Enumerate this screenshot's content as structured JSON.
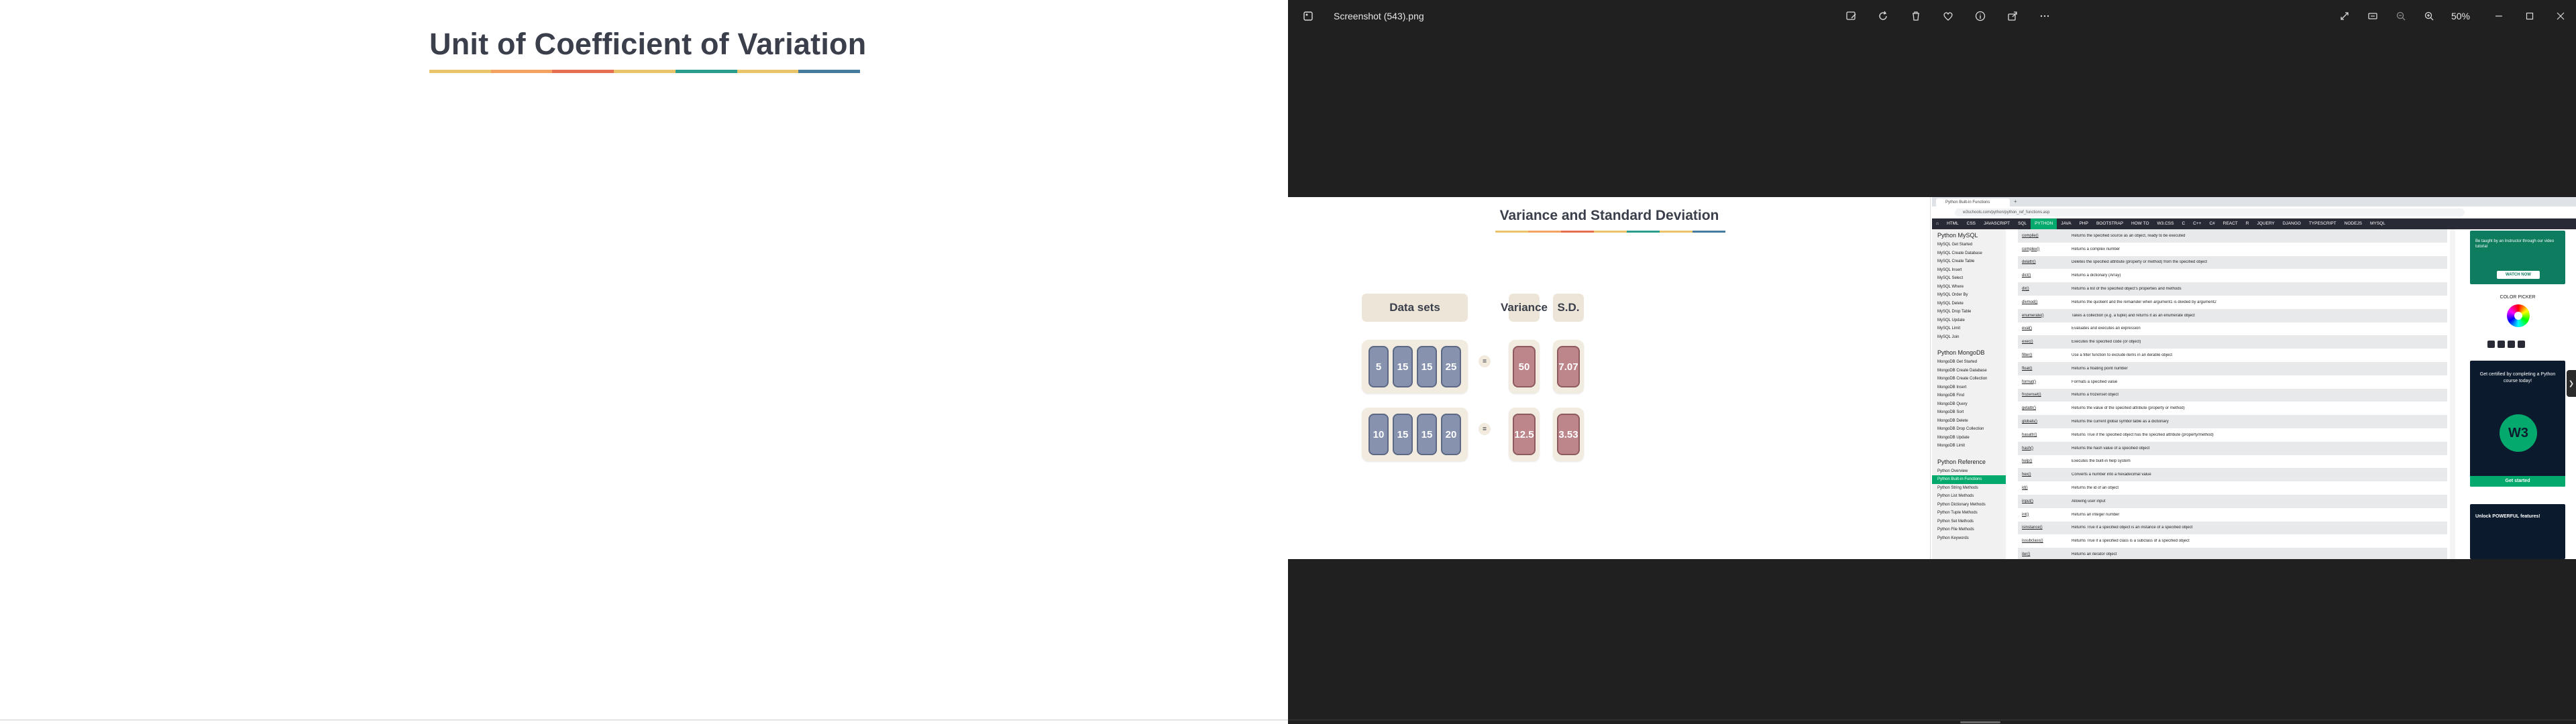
{
  "left_slide": {
    "title": "Unit of Coefficient of Variation",
    "stripe_colors": [
      "#e9c46a",
      "#f4a261",
      "#e76f51",
      "#e9c46a",
      "#2a9d8f",
      "#e9c46a",
      "#457b9d"
    ]
  },
  "viewer": {
    "file_name": "Screenshot (543).png",
    "zoom": "50%",
    "background": "#202020",
    "toolbar_icons": [
      "edit-image-icon",
      "rotate-icon",
      "delete-icon",
      "favorite-icon",
      "info-icon",
      "share-icon",
      "more-icon"
    ],
    "right_icons": [
      "expand-icon",
      "slideshow-icon",
      "zoom-out-icon",
      "zoom-in-icon"
    ],
    "window_controls": [
      "minimize-icon",
      "maximize-icon",
      "close-icon"
    ]
  },
  "screenshot": {
    "slide": {
      "title": "Variance and Standard Deviation",
      "headers": {
        "data_sets": "Data sets",
        "variance": "Variance",
        "sd": "S.D."
      },
      "rows": [
        {
          "values": [
            "5",
            "15",
            "15",
            "25"
          ],
          "eq": "=",
          "variance": "50",
          "sd": "7.07"
        },
        {
          "values": [
            "10",
            "15",
            "15",
            "20"
          ],
          "eq": "=",
          "variance": "12.5",
          "sd": "3.53"
        }
      ]
    },
    "browser": {
      "tab_title": "Python Built-in Functions",
      "url": "w3schools.com/python/python_ref_functions.asp",
      "nav_items": [
        "HTML",
        "CSS",
        "JAVASCRIPT",
        "SQL",
        "PYTHON",
        "JAVA",
        "PHP",
        "BOOTSTRAP",
        "HOW TO",
        "W3.CSS",
        "C",
        "C++",
        "C#",
        "REACT",
        "R",
        "JQUERY",
        "DJANGO",
        "TYPESCRIPT",
        "NODEJS",
        "MYSQL"
      ],
      "active_nav": "PYTHON",
      "sidebar": {
        "section1_title": "Python MySQL",
        "section1_items": [
          "MySQL Get Started",
          "MySQL Create Database",
          "MySQL Create Table",
          "MySQL Insert",
          "MySQL Select",
          "MySQL Where",
          "MySQL Order By",
          "MySQL Delete",
          "MySQL Drop Table",
          "MySQL Update",
          "MySQL Limit",
          "MySQL Join"
        ],
        "section2_title": "Python MongoDB",
        "section2_items": [
          "MongoDB Get Started",
          "MongoDB Create Database",
          "MongoDB Create Collection",
          "MongoDB Insert",
          "MongoDB Find",
          "MongoDB Query",
          "MongoDB Sort",
          "MongoDB Delete",
          "MongoDB Drop Collection",
          "MongoDB Update",
          "MongoDB Limit"
        ],
        "section3_title": "Python Reference",
        "section3_items": [
          "Python Overview",
          "Python Built-in Functions",
          "Python String Methods",
          "Python List Methods",
          "Python Dictionary Methods",
          "Python Tuple Methods",
          "Python Set Methods",
          "Python File Methods",
          "Python Keywords"
        ],
        "active_item": "Python Built-in Functions"
      },
      "functions": [
        {
          "name": "compile()",
          "desc": "Returns the specified source as an object, ready to be executed"
        },
        {
          "name": "complex()",
          "desc": "Returns a complex number"
        },
        {
          "name": "delattr()",
          "desc": "Deletes the specified attribute (property or method) from the specified object"
        },
        {
          "name": "dict()",
          "desc": "Returns a dictionary (Array)"
        },
        {
          "name": "dir()",
          "desc": "Returns a list of the specified object's properties and methods"
        },
        {
          "name": "divmod()",
          "desc": "Returns the quotient and the remainder when argument1 is divided by argument2"
        },
        {
          "name": "enumerate()",
          "desc": "Takes a collection (e.g. a tuple) and returns it as an enumerate object"
        },
        {
          "name": "eval()",
          "desc": "Evaluates and executes an expression"
        },
        {
          "name": "exec()",
          "desc": "Executes the specified code (or object)"
        },
        {
          "name": "filter()",
          "desc": "Use a filter function to exclude items in an iterable object"
        },
        {
          "name": "float()",
          "desc": "Returns a floating point number"
        },
        {
          "name": "format()",
          "desc": "Formats a specified value"
        },
        {
          "name": "frozenset()",
          "desc": "Returns a frozenset object"
        },
        {
          "name": "getattr()",
          "desc": "Returns the value of the specified attribute (property or method)"
        },
        {
          "name": "globals()",
          "desc": "Returns the current global symbol table as a dictionary"
        },
        {
          "name": "hasattr()",
          "desc": "Returns True if the specified object has the specified attribute (property/method)"
        },
        {
          "name": "hash()",
          "desc": "Returns the hash value of a specified object"
        },
        {
          "name": "help()",
          "desc": "Executes the built-in help system"
        },
        {
          "name": "hex()",
          "desc": "Converts a number into a hexadecimal value"
        },
        {
          "name": "id()",
          "desc": "Returns the id of an object"
        },
        {
          "name": "input()",
          "desc": "Allowing user input"
        },
        {
          "name": "int()",
          "desc": "Returns an integer number"
        },
        {
          "name": "isinstance()",
          "desc": "Returns True if a specified object is an instance of a specified object"
        },
        {
          "name": "issubclass()",
          "desc": "Returns True if a specified class is a subclass of a specified object"
        },
        {
          "name": "iter()",
          "desc": "Returns an iterator object"
        }
      ],
      "ads": {
        "ad1_text": "Be taught by an Instructor through our video tutorial",
        "ad1_button": "WATCH NOW",
        "color_picker": "COLOR PICKER",
        "ad2_text": "Get certified by completing a Python course today!",
        "ad2_logo": "W3",
        "ad2_button": "Get started",
        "ad3_text": "Unlock POWERFUL features!"
      }
    }
  }
}
